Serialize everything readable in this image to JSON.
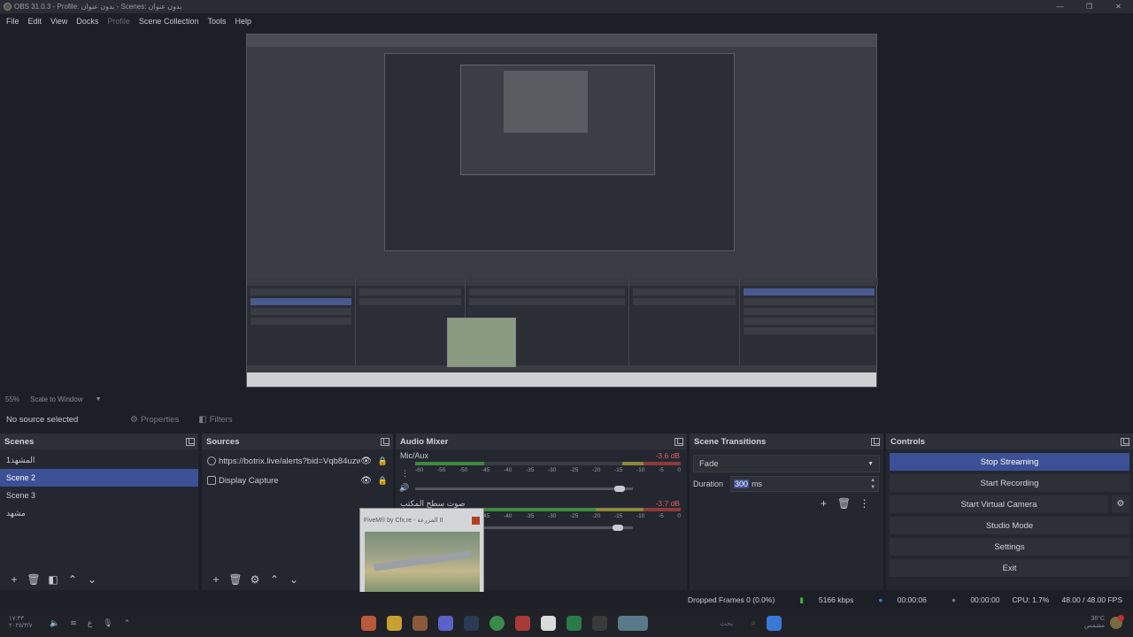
{
  "window": {
    "title": "OBS 31.0.3 - Profile: بدون عنوان - Scenes: بدون عنوان",
    "controls": [
      "—",
      "❐",
      "✕"
    ]
  },
  "menu": {
    "items": [
      "File",
      "Edit",
      "View",
      "Docks",
      "Profile",
      "Scene Collection",
      "Tools",
      "Help"
    ]
  },
  "preview": {
    "zoom": "55%",
    "scale_mode": "Scale to Window"
  },
  "source_toolbar": {
    "status": "No source selected",
    "properties_label": "Properties",
    "filters_label": "Filters"
  },
  "scenes": {
    "title": "Scenes",
    "items": [
      "المشهد1",
      "Scene 2",
      "Scene 3",
      "مشهد"
    ],
    "selected_index": 1
  },
  "sources": {
    "title": "Sources",
    "items": [
      {
        "name": "https://botrix.live/alerts?bid=Vqb84uzw",
        "icon": "globe-icon"
      },
      {
        "name": "Display Capture",
        "icon": "monitor-icon"
      }
    ]
  },
  "audio_mixer": {
    "title": "Audio Mixer",
    "channels": [
      {
        "name": "Mic/Aux",
        "db": "-3.6 dB",
        "level": 0.26,
        "volume": 0.94
      },
      {
        "name": "صوت سطح المكتب",
        "db": "-3.7 dB",
        "level": 0.68,
        "volume": 0.93
      }
    ],
    "ticks": [
      "-60",
      "-55",
      "-50",
      "-45",
      "-40",
      "-35",
      "-30",
      "-25",
      "-20",
      "-15",
      "-10",
      "-5",
      "0"
    ]
  },
  "scene_transitions": {
    "title": "Scene Transitions",
    "transition": "Fade",
    "duration_label": "Duration",
    "duration_value": "300",
    "duration_unit": "ms"
  },
  "controls": {
    "title": "Controls",
    "stop_streaming": "Stop Streaming",
    "start_recording": "Start Recording",
    "start_virtual_camera": "Start Virtual Camera",
    "studio_mode": "Studio Mode",
    "settings": "Settings",
    "exit": "Exit"
  },
  "overlay": {
    "title": "FiveM® by Cfx.re - المزرعة II"
  },
  "status": {
    "dropped_frames": "Dropped Frames 0 (0.0%)",
    "bitrate": "5166 kbps",
    "stream_time": "00:00:06",
    "record_time": "00:00:00",
    "cpu": "CPU: 1.7%",
    "fps": "48.00 / 48.00 FPS"
  },
  "taskbar": {
    "time": "١٧:٣٣",
    "date": "٢٠٢٥/٣/٧",
    "search_placeholder": "بحث",
    "temperature": "36°C",
    "weather_text": "مشمس"
  },
  "colors": {
    "accent": "#3c5096",
    "background": "#1d1f26",
    "panel": "#252730"
  }
}
